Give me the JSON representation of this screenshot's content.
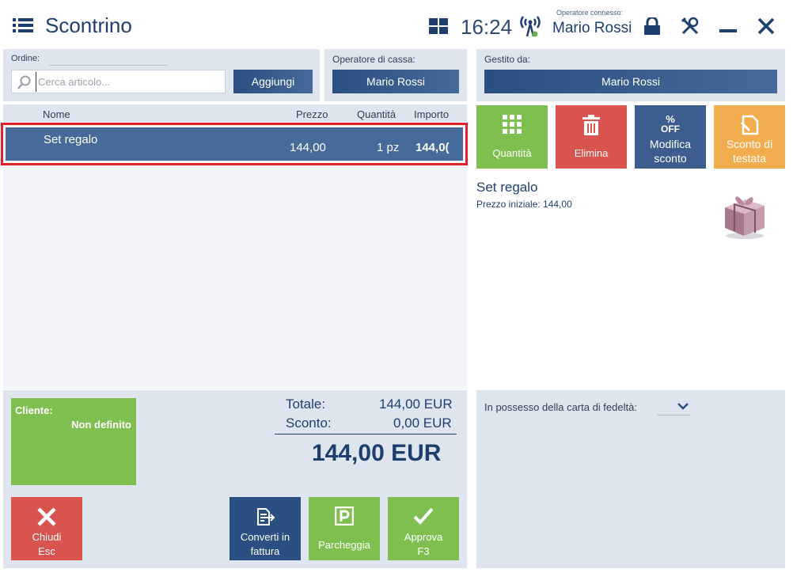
{
  "header": {
    "title": "Scontrino",
    "time": "16:24",
    "operator_caption": "Operatore connesso:",
    "operator_name": "Mario Rossi"
  },
  "order": {
    "label": "Ordine:",
    "search_placeholder": "Cerca articolo...",
    "add_button": "Aggiungi"
  },
  "cashier": {
    "label": "Operatore di cassa:",
    "value": "Mario Rossi"
  },
  "managed_by": {
    "label": "Gestito da:",
    "value": "Mario Rossi"
  },
  "table": {
    "columns": [
      "Nome",
      "Prezzo",
      "Quantità",
      "Importo"
    ],
    "rows": [
      {
        "name": "Set regalo",
        "price": "144,00",
        "quantity": "1 pz",
        "amount": "144,0("
      }
    ]
  },
  "actions": {
    "quantity": "Quantità",
    "delete": "Elimina",
    "edit_discount_1": "Modifica",
    "edit_discount_2": "sconto",
    "off_badge_top": "%",
    "off_badge_bottom": "OFF",
    "header_discount_1": "Sconto di",
    "header_discount_2": "testata"
  },
  "detail": {
    "name": "Set regalo",
    "initial_price": "Prezzo iniziale: 144,00"
  },
  "client": {
    "label": "Cliente:",
    "value": "Non definito"
  },
  "totals": {
    "total_label": "Totale:",
    "total_value": "144,00 EUR",
    "discount_label": "Sconto:",
    "discount_value": "0,00 EUR",
    "grand_total": "144,00 EUR"
  },
  "bottom_buttons": {
    "close_1": "Chiudi",
    "close_2": "Esc",
    "invoice_1": "Converti in",
    "invoice_2": "fattura",
    "park": "Parcheggia",
    "approve_1": "Approva",
    "approve_2": "F3"
  },
  "loyalty": {
    "label": "In possesso della carta di fedeltà:"
  },
  "colors": {
    "green": "#7fbf4f",
    "red": "#d9534f",
    "navy": "#2a4f80",
    "orange": "#f0ac4d",
    "selection_border": "#e0202a"
  }
}
